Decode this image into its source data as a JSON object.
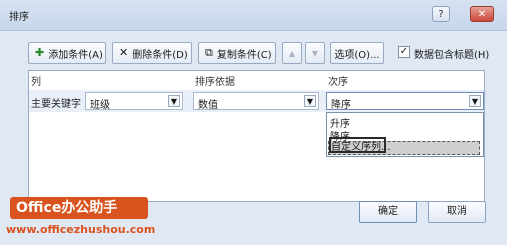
{
  "window": {
    "title": "排序",
    "help_label": "?",
    "close_label": "✕"
  },
  "toolbar": {
    "add_level": "添加条件(A)",
    "delete_level": "删除条件(D)",
    "copy_level": "复制条件(C)",
    "move_up": "▲",
    "move_down": "▼",
    "options": "选项(O)...",
    "header_checkbox": {
      "label": "数据包含标题(H)",
      "checked": true,
      "mark": "✓"
    }
  },
  "grid": {
    "headers": {
      "column": "列",
      "sort_on": "排序依据",
      "order": "次序"
    },
    "row": {
      "label": "主要关键字",
      "column_value": "班级",
      "sort_on_value": "数值",
      "order_value": "降序",
      "dropdown_arrow": "▼"
    },
    "order_options": [
      "升序",
      "降序",
      "自定义序列..."
    ]
  },
  "footer": {
    "ok": "确定",
    "cancel": "取消"
  },
  "watermark": {
    "brand": "Office办公助手",
    "url": "www.officezhushou.com"
  },
  "icons": {
    "add": "add-icon",
    "delete": "delete-x-icon",
    "copy": "copy-icon"
  },
  "colors": {
    "accent": "#d9531e",
    "dialog_bg": "#dfe8f3",
    "selection": "#cfcfcf"
  }
}
